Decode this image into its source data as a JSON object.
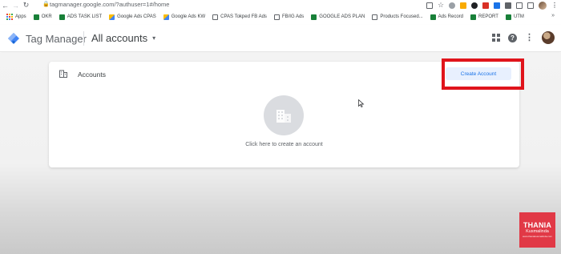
{
  "browser": {
    "url": "tagmanager.google.com/?authuser=1#/home",
    "bookmarks": [
      {
        "label": "Apps",
        "icon": "apps-grid-icon",
        "color": "#5f6368"
      },
      {
        "label": "OKR",
        "icon": "sheets-icon",
        "color": "#188038"
      },
      {
        "label": "ADS TASK LIST",
        "icon": "sheets-icon",
        "color": "#188038"
      },
      {
        "label": "Google Ads CPAS",
        "icon": "google-ads-icon",
        "color": "#fbbc04"
      },
      {
        "label": "Google Ads KW",
        "icon": "google-ads-icon",
        "color": "#fbbc04"
      },
      {
        "label": "CPAS Tokped FB Ads",
        "icon": "doc-icon",
        "color": "#5f6368"
      },
      {
        "label": "FB/IG Ads",
        "icon": "doc-icon",
        "color": "#5f6368"
      },
      {
        "label": "GOOGLE ADS PLAN",
        "icon": "sheets-icon",
        "color": "#188038"
      },
      {
        "label": "Products Focused...",
        "icon": "doc-icon",
        "color": "#5f6368"
      },
      {
        "label": "Ads Record",
        "icon": "sheets-icon",
        "color": "#188038"
      },
      {
        "label": "REPORT",
        "icon": "sheets-icon",
        "color": "#188038"
      },
      {
        "label": "UTM",
        "icon": "sheets-icon",
        "color": "#188038"
      }
    ],
    "more": "»"
  },
  "header": {
    "product_name": "Tag Manager",
    "breadcrumb": "All accounts",
    "caret": "▾"
  },
  "card": {
    "title": "Accounts",
    "create_button": "Create Account",
    "empty_text": "Click here to create an account"
  },
  "watermark": {
    "line1": "THANIA",
    "line2": "Kusmalinda",
    "line3": "www.thaniakusmalinda.com"
  },
  "colors": {
    "accent": "#1a73e8",
    "highlight": "#e0141b",
    "watermark": "#e13946"
  }
}
